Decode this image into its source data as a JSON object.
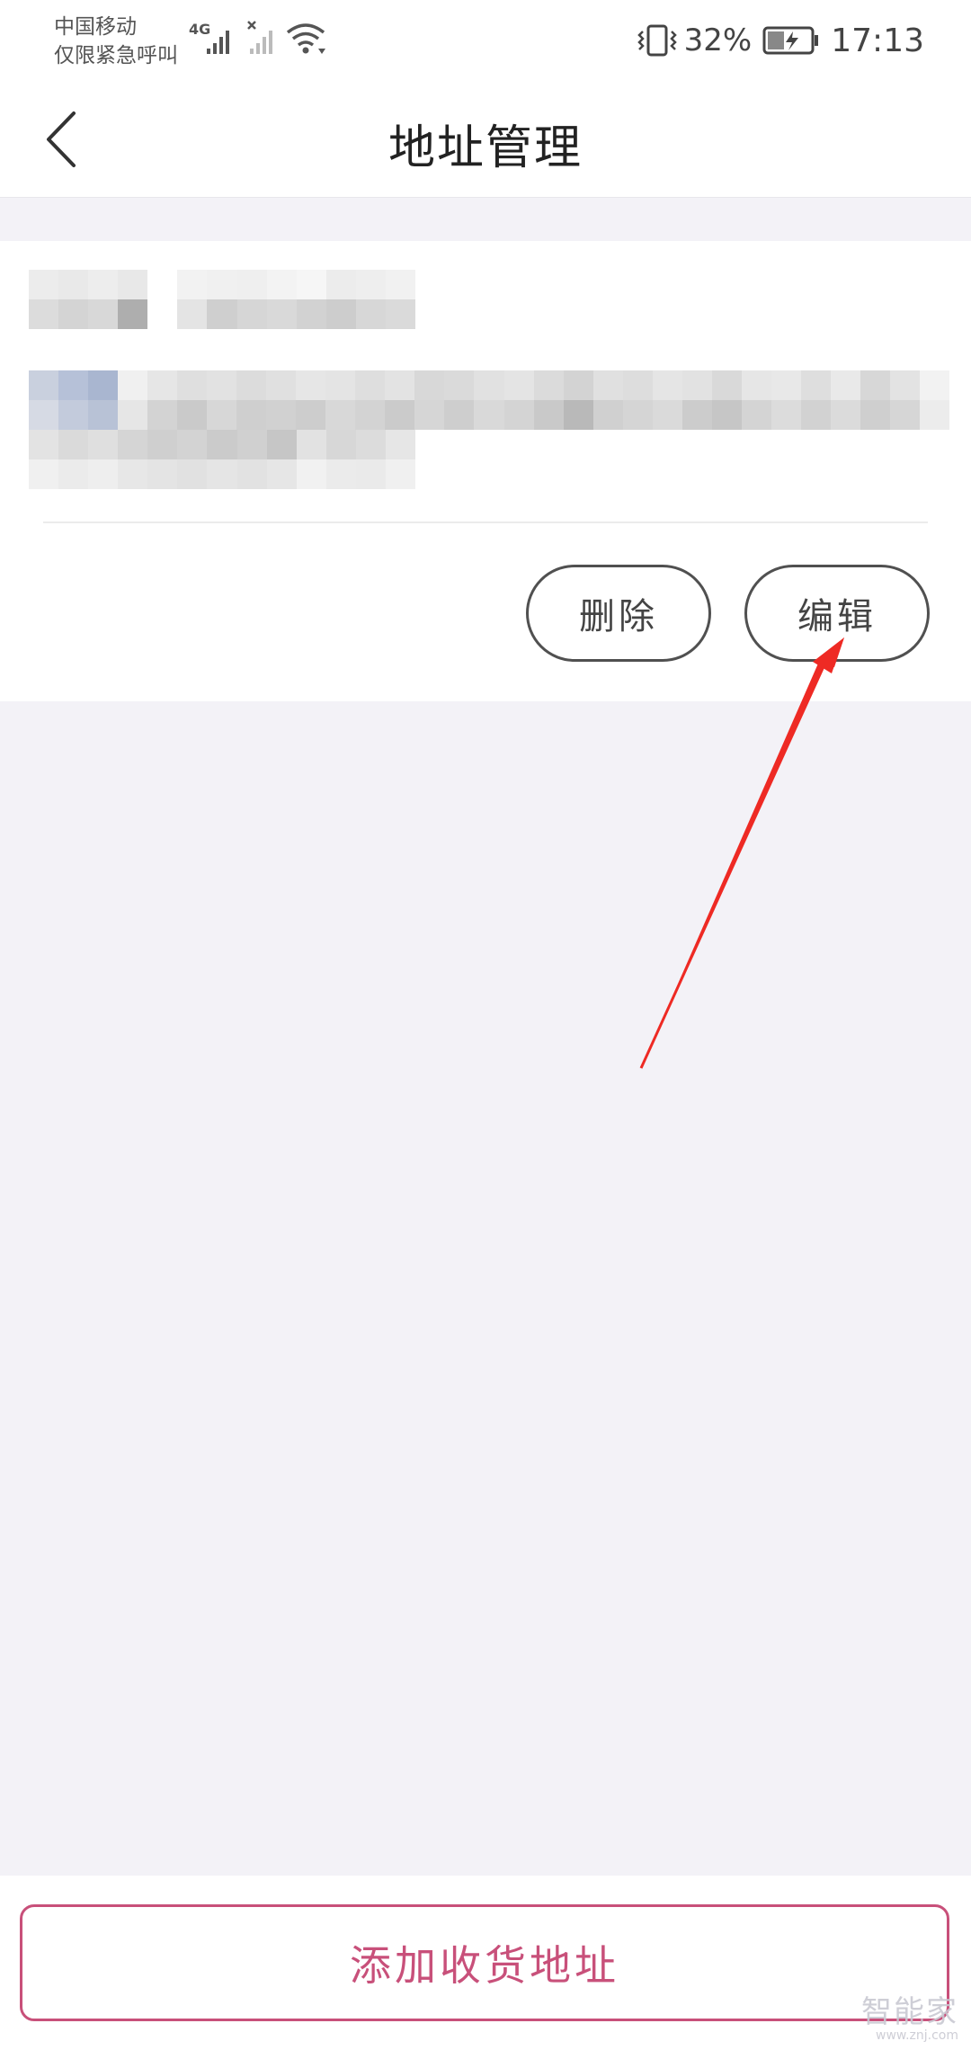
{
  "status_bar": {
    "carrier_line1": "中国移动",
    "carrier_line2": "仅限紧急呼叫",
    "network_label": "4G",
    "battery_percent": "32%",
    "time": "17:13",
    "icons": [
      "signal-icon",
      "no-signal-icon",
      "wifi-icon",
      "vibrate-icon",
      "battery-charging-icon"
    ]
  },
  "nav": {
    "title": "地址管理",
    "back_icon": "chevron-left-icon"
  },
  "address_card": {
    "delete_label": "删除",
    "edit_label": "编辑"
  },
  "bottom": {
    "add_address_label": "添加收货地址"
  },
  "watermark": {
    "main": "智能家",
    "sub": "www.znj.com"
  },
  "colors": {
    "accent": "#c8507a",
    "annotation": "#ee2a24",
    "page_background": "#f3f2f7"
  }
}
